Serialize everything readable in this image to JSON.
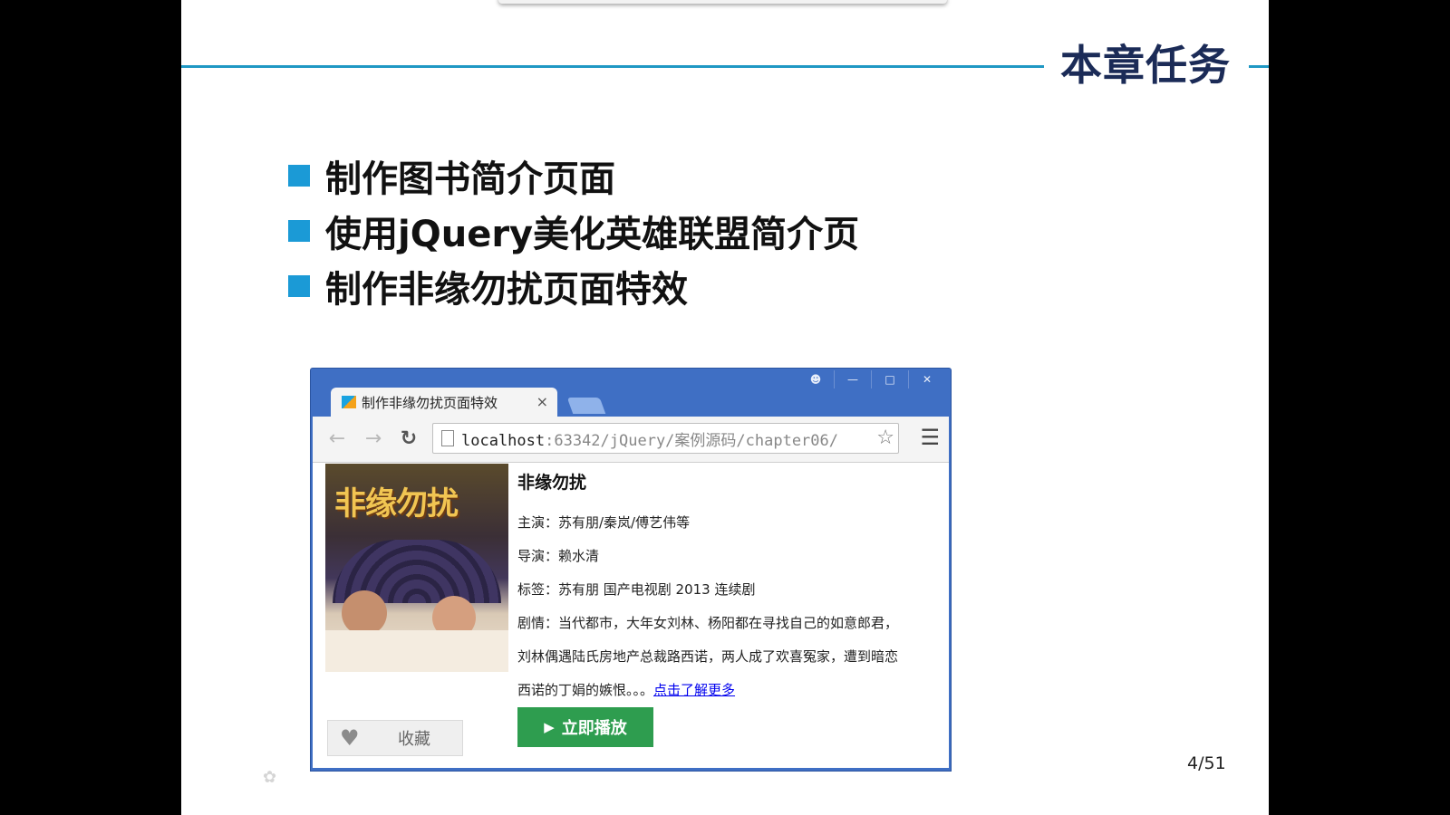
{
  "slide": {
    "title": "本章任务",
    "tasks": [
      "制作图书简介页面",
      "使用jQuery美化英雄联盟简介页",
      "制作非缘勿扰页面特效"
    ],
    "page_number": "4/51",
    "accent_color": "#1f98c4",
    "bullet_color": "#1b9ad6",
    "title_color": "#1b2b57"
  },
  "browser": {
    "tab_title": "制作非缘勿扰页面特效",
    "tab_close": "×",
    "window_controls": [
      "user-icon",
      "minimize-icon",
      "maximize-icon",
      "close-icon"
    ],
    "url_host": "localhost",
    "url_rest": ":63342/jQuery/案例源码/chapter06/",
    "frame_color": "#3f6fc4"
  },
  "page": {
    "poster_title": "非缘勿扰",
    "title": "非缘勿扰",
    "lines": [
      "主演：苏有朋/秦岚/傅艺伟等",
      "导演：赖水清",
      "标签：苏有朋  国产电视剧  2013  连续剧",
      "剧情：当代都市，大年女刘林、杨阳都在寻找自己的如意郎君，",
      "刘林偶遇陆氏房地产总裁路西诺，两人成了欢喜冤家，遭到暗恋"
    ],
    "last_line": "西诺的丁娟的嫉恨。。。",
    "more_link": "点击了解更多",
    "favorite_label": "收藏",
    "play_label": "立即播放",
    "play_color": "#2e9d4f"
  }
}
